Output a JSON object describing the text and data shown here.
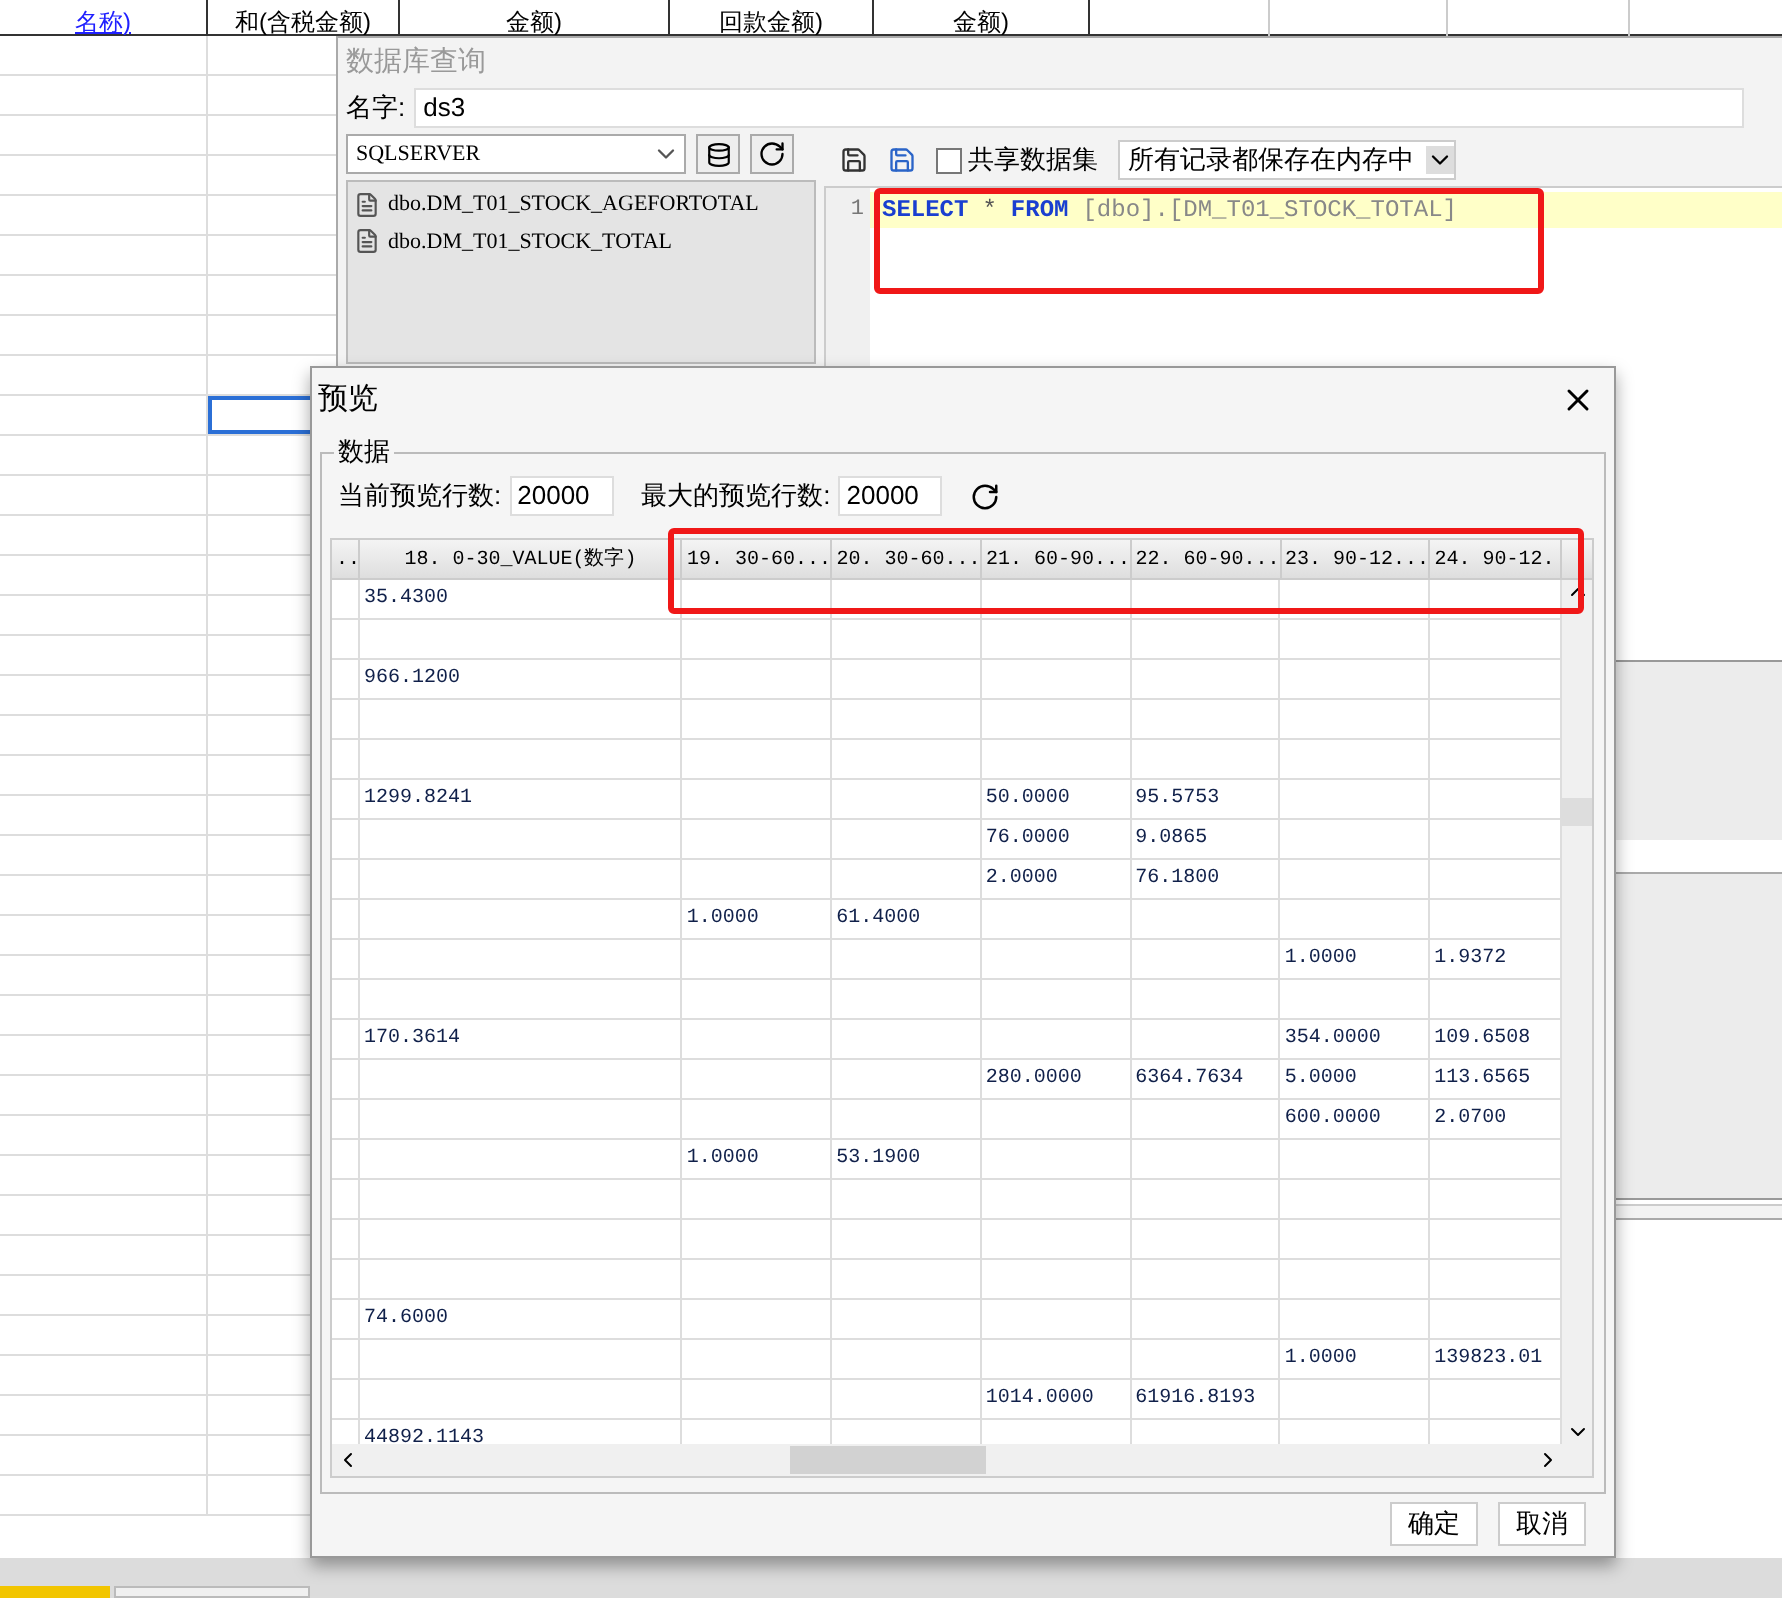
{
  "sheet": {
    "header_cells": [
      {
        "text": "名称)",
        "kind": "link"
      },
      {
        "text": "和(含税金额)",
        "kind": "plain"
      },
      {
        "text": "金额)",
        "kind": "plain"
      },
      {
        "text": "回款金额)",
        "kind": "plain"
      },
      {
        "text": "金额)",
        "kind": "plain"
      }
    ]
  },
  "query_dialog": {
    "title": "数据库查询",
    "name_label": "名字:",
    "name_value": "ds3",
    "datasource": "SQLSERVER",
    "tables": [
      "dbo.DM_T01_STOCK_AGEFORTOTAL",
      "dbo.DM_T01_STOCK_TOTAL"
    ],
    "share_dataset": {
      "label": "共享数据集",
      "checked": false
    },
    "storage_mode": "所有记录都保存在内存中",
    "editor": {
      "line_number": "1",
      "tokens": [
        {
          "text": "SELECT",
          "kind": "keyword"
        },
        {
          "text": "*",
          "kind": "operator"
        },
        {
          "text": "FROM",
          "kind": "keyword"
        },
        {
          "text": "[dbo].[DM_T01_STOCK_TOTAL]",
          "kind": "identifier"
        }
      ]
    }
  },
  "preview_dialog": {
    "title": "预览",
    "group_label": "数据",
    "current_rows_label": "当前预览行数:",
    "current_rows": "20000",
    "max_rows_label": "最大的预览行数:",
    "max_rows": "20000",
    "columns": [
      "..",
      "18. 0-30_VALUE(数字)",
      "19. 30-60...",
      "20. 30-60...",
      "21. 60-90...",
      "22. 60-90...",
      "23. 90-12...",
      "24. 90-12."
    ],
    "rows": [
      [
        "",
        "35.4300",
        "",
        "",
        "",
        "",
        "",
        ""
      ],
      [
        "",
        "",
        "",
        "",
        "",
        "",
        "",
        ""
      ],
      [
        "",
        "966.1200",
        "",
        "",
        "",
        "",
        "",
        ""
      ],
      [
        "",
        "",
        "",
        "",
        "",
        "",
        "",
        ""
      ],
      [
        "",
        "",
        "",
        "",
        "",
        "",
        "",
        ""
      ],
      [
        "",
        "1299.8241",
        "",
        "",
        "50.0000",
        "95.5753",
        "",
        ""
      ],
      [
        "",
        "",
        "",
        "",
        "76.0000",
        "9.0865",
        "",
        ""
      ],
      [
        "",
        "",
        "",
        "",
        "2.0000",
        "76.1800",
        "",
        ""
      ],
      [
        "",
        "",
        "1.0000",
        "61.4000",
        "",
        "",
        "",
        ""
      ],
      [
        "",
        "",
        "",
        "",
        "",
        "",
        "1.0000",
        "1.9372"
      ],
      [
        "",
        "",
        "",
        "",
        "",
        "",
        "",
        ""
      ],
      [
        "",
        "170.3614",
        "",
        "",
        "",
        "",
        "354.0000",
        "109.6508"
      ],
      [
        "",
        "",
        "",
        "",
        "280.0000",
        "6364.7634",
        "5.0000",
        "113.6565"
      ],
      [
        "",
        "",
        "",
        "",
        "",
        "",
        "600.0000",
        "2.0700"
      ],
      [
        "",
        "",
        "1.0000",
        "53.1900",
        "",
        "",
        "",
        ""
      ],
      [
        "",
        "",
        "",
        "",
        "",
        "",
        "",
        ""
      ],
      [
        "",
        "",
        "",
        "",
        "",
        "",
        "",
        ""
      ],
      [
        "",
        "",
        "",
        "",
        "",
        "",
        "",
        ""
      ],
      [
        "",
        "74.6000",
        "",
        "",
        "",
        "",
        "",
        ""
      ],
      [
        "",
        "",
        "",
        "",
        "",
        "",
        "1.0000",
        "139823.01"
      ],
      [
        "",
        "",
        "",
        "",
        "1014.0000",
        "61916.8193",
        "",
        ""
      ],
      [
        "",
        "44892.1143",
        "",
        "",
        "",
        "",
        "",
        ""
      ]
    ],
    "buttons": [
      "确定",
      "取消"
    ]
  }
}
